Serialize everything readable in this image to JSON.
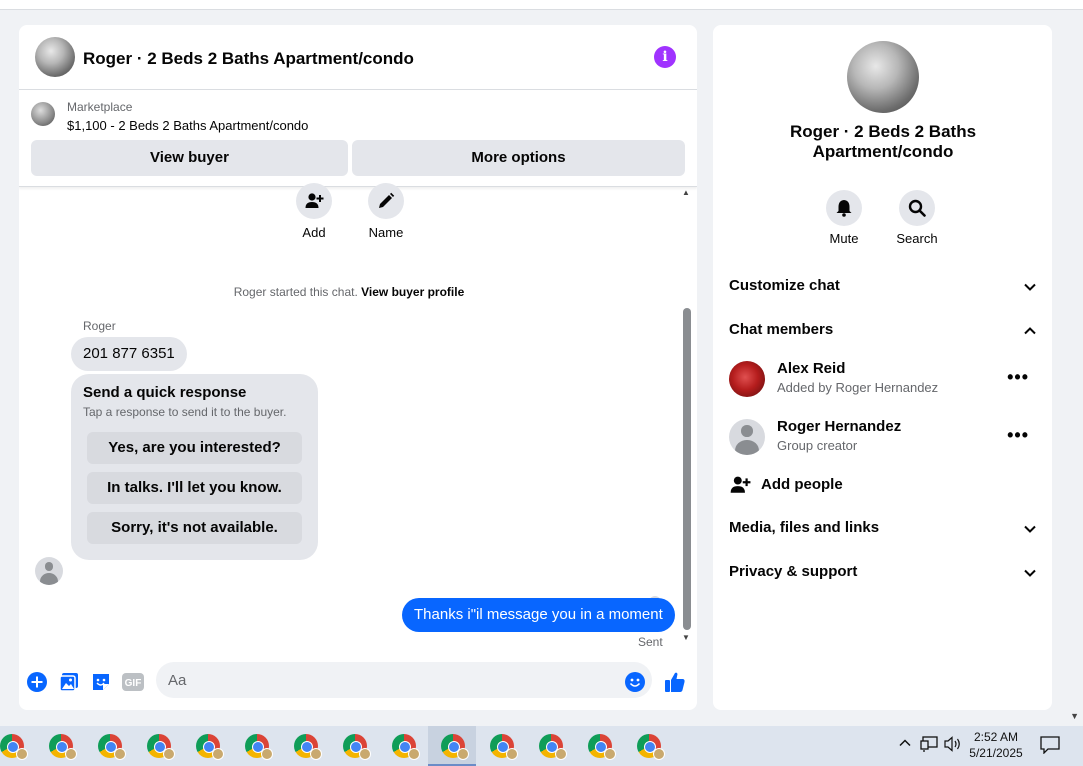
{
  "chat": {
    "title": "Roger · 2 Beds 2 Baths Apartment/condo",
    "marketplace_label": "Marketplace",
    "listing": "$1,100 - 2 Beds 2 Baths Apartment/condo",
    "view_buyer_label": "View buyer",
    "more_options_label": "More options",
    "actions": [
      {
        "label": "Add",
        "icon": "add-person-icon"
      },
      {
        "label": "Name",
        "icon": "pencil-icon"
      }
    ],
    "system_text": "Roger started this chat.",
    "system_link": "View buyer profile",
    "sender_name": "Roger",
    "incoming_message": "201 877 6351",
    "quick_response": {
      "title": "Send a quick response",
      "subtitle": "Tap a response to send it to the buyer.",
      "options": [
        "Yes, are you interested?",
        "In talks. I'll let you know.",
        "Sorry, it's not available."
      ]
    },
    "outgoing_message": "Thanks i\"il message you in a moment",
    "status": "Sent",
    "composer_placeholder": "Aa",
    "composer_icons": [
      "plus-icon",
      "photo-icon",
      "sticker-icon",
      "gif-icon",
      "emoji-icon",
      "thumbs-up-icon"
    ],
    "gif_label": "GIF",
    "accent_color": "#0866ff",
    "info_color": "#a033ff"
  },
  "side": {
    "title": "Roger · 2 Beds 2 Baths Apartment/condo",
    "actions": [
      {
        "label": "Mute",
        "icon": "bell-icon"
      },
      {
        "label": "Search",
        "icon": "search-icon"
      }
    ],
    "sections": {
      "customize": "Customize chat",
      "members": "Chat members",
      "media": "Media, files and links",
      "privacy": "Privacy & support"
    },
    "members": [
      {
        "name": "Alex Reid",
        "sub": "Added by Roger Hernandez"
      },
      {
        "name": "Roger Hernandez",
        "sub": "Group creator"
      }
    ],
    "add_people": "Add people"
  },
  "taskbar": {
    "time": "2:52 AM",
    "date": "5/21/2025",
    "app_count": 14
  }
}
